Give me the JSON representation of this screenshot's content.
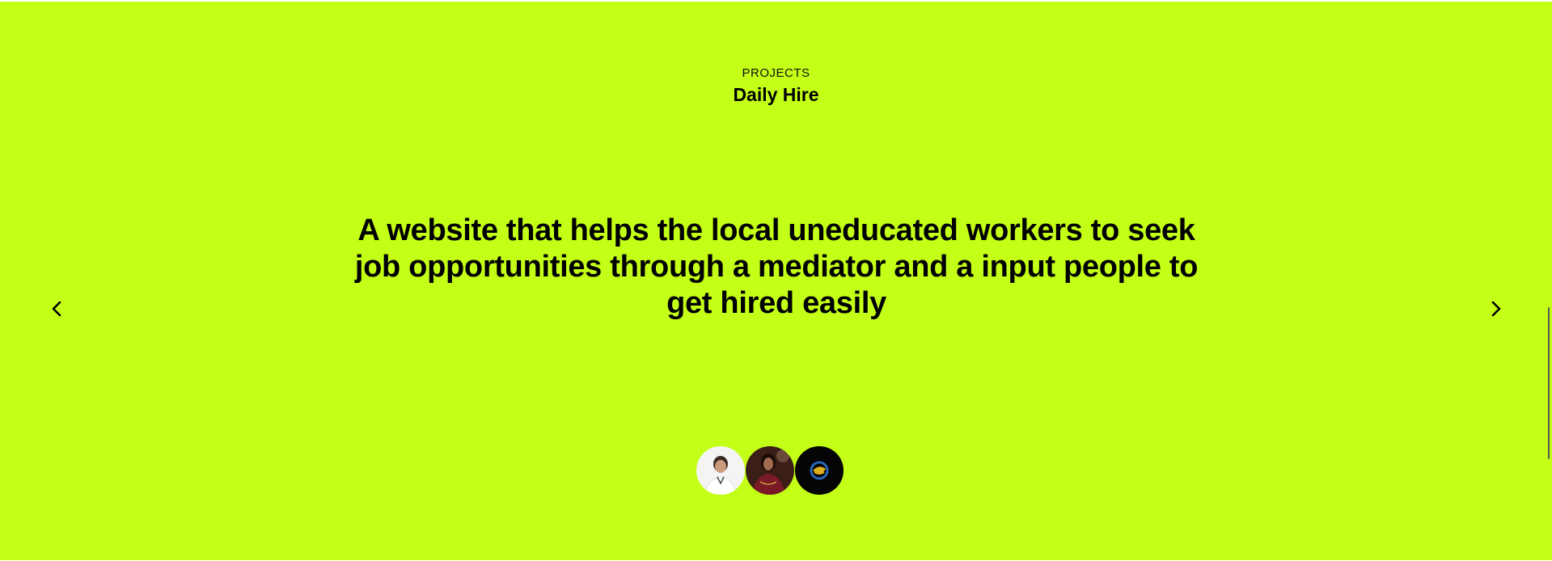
{
  "section": {
    "eyebrow": "PROJECTS",
    "title": "Daily Hire",
    "headline": "A website that helps the local uneducated workers to seek job opportunities through a mediator and a input people to get hired easily"
  },
  "carousel": {
    "prev_icon": "chevron-left-icon",
    "next_icon": "chevron-right-icon"
  },
  "team": {
    "avatars": [
      {
        "name": "avatar-1",
        "style": "light-background-portrait"
      },
      {
        "name": "avatar-2",
        "style": "dark-red-portrait"
      },
      {
        "name": "avatar-3",
        "style": "dark-logo"
      }
    ]
  },
  "colors": {
    "background": "#c4ff17",
    "text": "#000000"
  }
}
